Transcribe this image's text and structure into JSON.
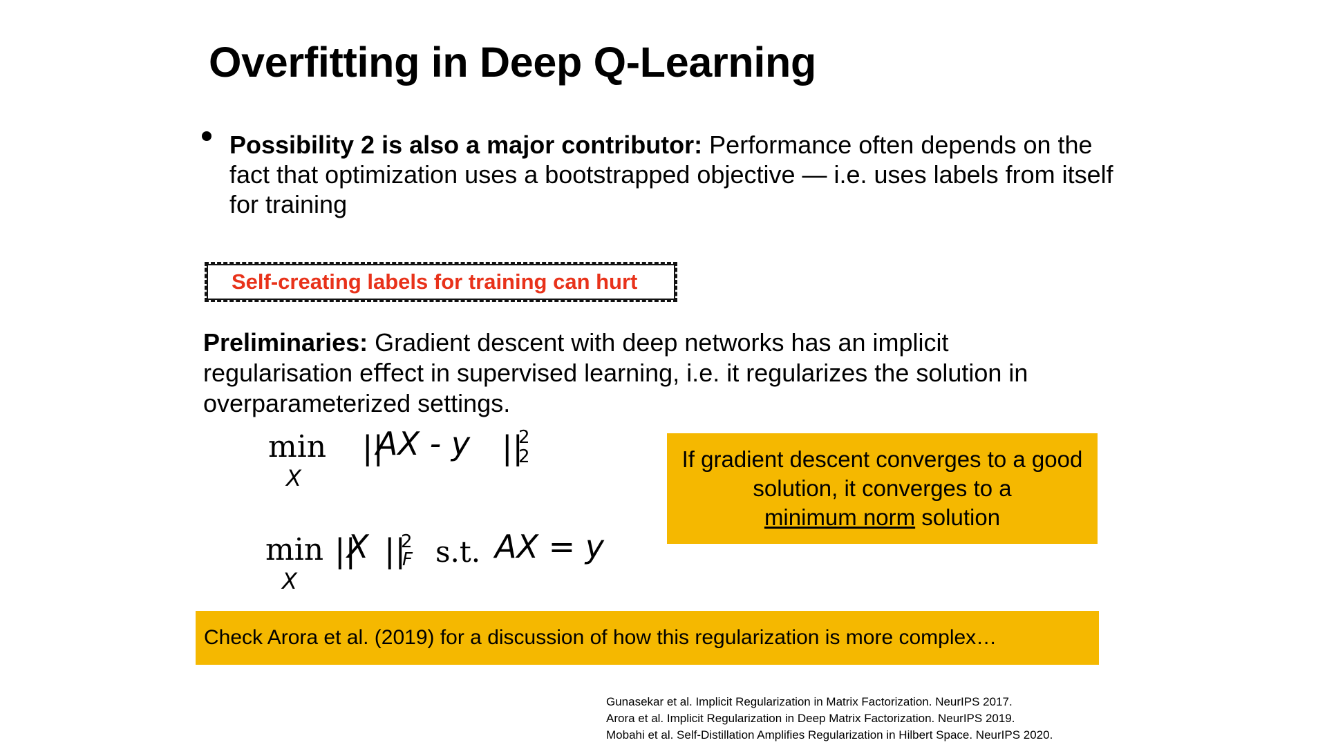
{
  "slide": {
    "title": "Overfitting in Deep Q-Learning",
    "bullet": {
      "bold": "Possibility 2 is also a major contributor:",
      "text": " Performance often depends on the fact that optimization uses a bootstrapped objective — i.e. uses labels from itself for training"
    },
    "callout": "Self-creating labels for training can hurt",
    "preliminaries": {
      "bold": "Preliminaries:",
      "text": " Gradient descent with deep networks has an implicit regularisation eﬀect in supervised learning, i.e. it regularizes the solution in overparameterized settings."
    },
    "equation1": {
      "min": "min",
      "var": "X",
      "open": "||",
      "body": "AX - y",
      "close": "||",
      "sup": "2",
      "sub": "2"
    },
    "equation2": {
      "min": "min",
      "var": "X",
      "open": "||",
      "body": "X",
      "close": "||",
      "sup": "2",
      "sub": "F",
      "st": "s.t.",
      "rhs": "AX = y"
    },
    "yellow_box": {
      "line1": "If gradient descent converges to a good solution, it converges to a",
      "underlined": "minimum norm",
      "line3": " solution"
    },
    "bottom_bar": "Check Arora et al. (2019) for a discussion of how this regularization is more complex…",
    "references": [
      "Gunasekar et al. Implicit Regularization in Matrix Factorization. NeurIPS 2017.",
      "Arora et al. Implicit Regularization in Deep Matrix Factorization. NeurIPS 2019.",
      "Mobahi et al. Self-Distillation Amplifies Regularization in Hilbert Space. NeurIPS 2020."
    ],
    "colors": {
      "callout_text": "#e8321a",
      "highlight": "#f5b800"
    }
  }
}
